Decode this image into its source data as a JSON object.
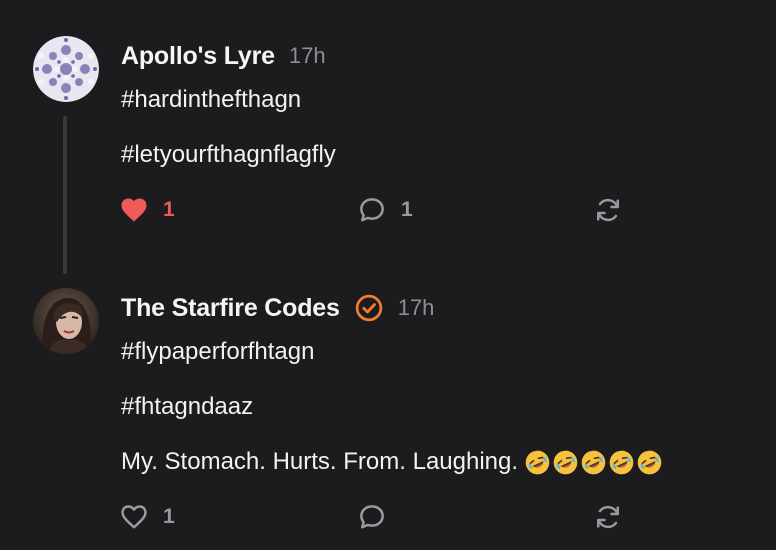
{
  "posts": [
    {
      "author": "Apollo's Lyre",
      "time": "17h",
      "verified": false,
      "paragraphs": [
        "#hardinthefthagn",
        "#letyourfthagnflagfly"
      ],
      "likes": "1",
      "liked": true,
      "replies": "1",
      "reposts": ""
    },
    {
      "author": "The Starfire Codes",
      "time": "17h",
      "verified": true,
      "paragraphs": [
        "#flypaperforfhtagn",
        "#fhtagndaaz",
        "My. Stomach. Hurts. From. Laughing."
      ],
      "emoji_count": 5,
      "likes": "1",
      "liked": false,
      "replies": "",
      "reposts": ""
    }
  ],
  "colors": {
    "background": "#1c1c1e",
    "like_active": "#ef5b5b",
    "verified_badge": "#f07c2e",
    "muted": "#8e8e93"
  },
  "icons": {
    "like": "heart-icon",
    "reply": "speech-bubble-icon",
    "repost": "repost-arrows-icon",
    "verified": "verified-check-icon",
    "emoji": "rolling-on-floor-laughing-emoji"
  }
}
